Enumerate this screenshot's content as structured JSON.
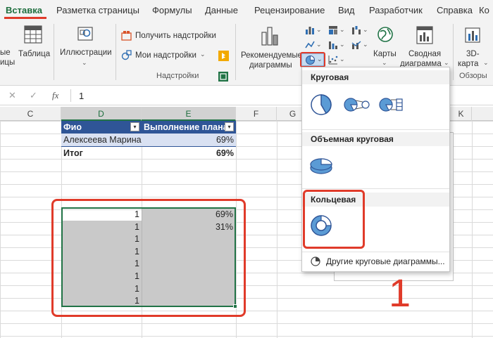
{
  "ribbon": {
    "tabs": [
      "Вставка",
      "Разметка страницы",
      "Формулы",
      "Данные",
      "Рецензирование",
      "Вид",
      "Разработчик",
      "Справка",
      "Ко"
    ],
    "active_tab": "Вставка",
    "tables_partial_1": "ые",
    "tables_partial_2": "ицы",
    "table_label": "Таблица",
    "illustrations_label": "Иллюстрации",
    "get_addins_label": "Получить надстройки",
    "my_addins_label": "Мои надстройки",
    "addins_group": "Надстройки",
    "recommended_charts_line1": "Рекомендуемые",
    "recommended_charts_line2": "диаграммы",
    "maps_label": "Карты",
    "pivot_chart_line1": "Сводная",
    "pivot_chart_line2": "диаграмма",
    "map3d_line1": "3D-",
    "map3d_line2": "карта",
    "tours_group": "Обзоры"
  },
  "formula_bar": {
    "value": "1"
  },
  "columns": [
    "C",
    "D",
    "E",
    "F",
    "G",
    "K"
  ],
  "table": {
    "headers": [
      "Фио",
      "Выполнение плана"
    ],
    "rows": [
      {
        "name": "Алексеева Марина",
        "value": "69%"
      },
      {
        "name": "Итог",
        "value": "69%"
      }
    ]
  },
  "helper_range": {
    "d_values": [
      "1",
      "1",
      "1",
      "1",
      "1",
      "1",
      "1",
      "1"
    ],
    "e_values": [
      "69%",
      "31%",
      "",
      "",
      "",
      "",
      "",
      ""
    ]
  },
  "dropdown": {
    "pie_header": "Круговая",
    "pie3d_header": "Объемная круговая",
    "donut_header": "Кольцевая",
    "more_label": "Другие круговые диаграммы..."
  },
  "annotation": {
    "step_number": "1",
    "accent_color": "#e03b2a"
  },
  "colors": {
    "excel_green": "#217346",
    "table_header": "#2f5597",
    "table_band": "#d9e1f2",
    "chart_blue": "#5b9bd5"
  }
}
